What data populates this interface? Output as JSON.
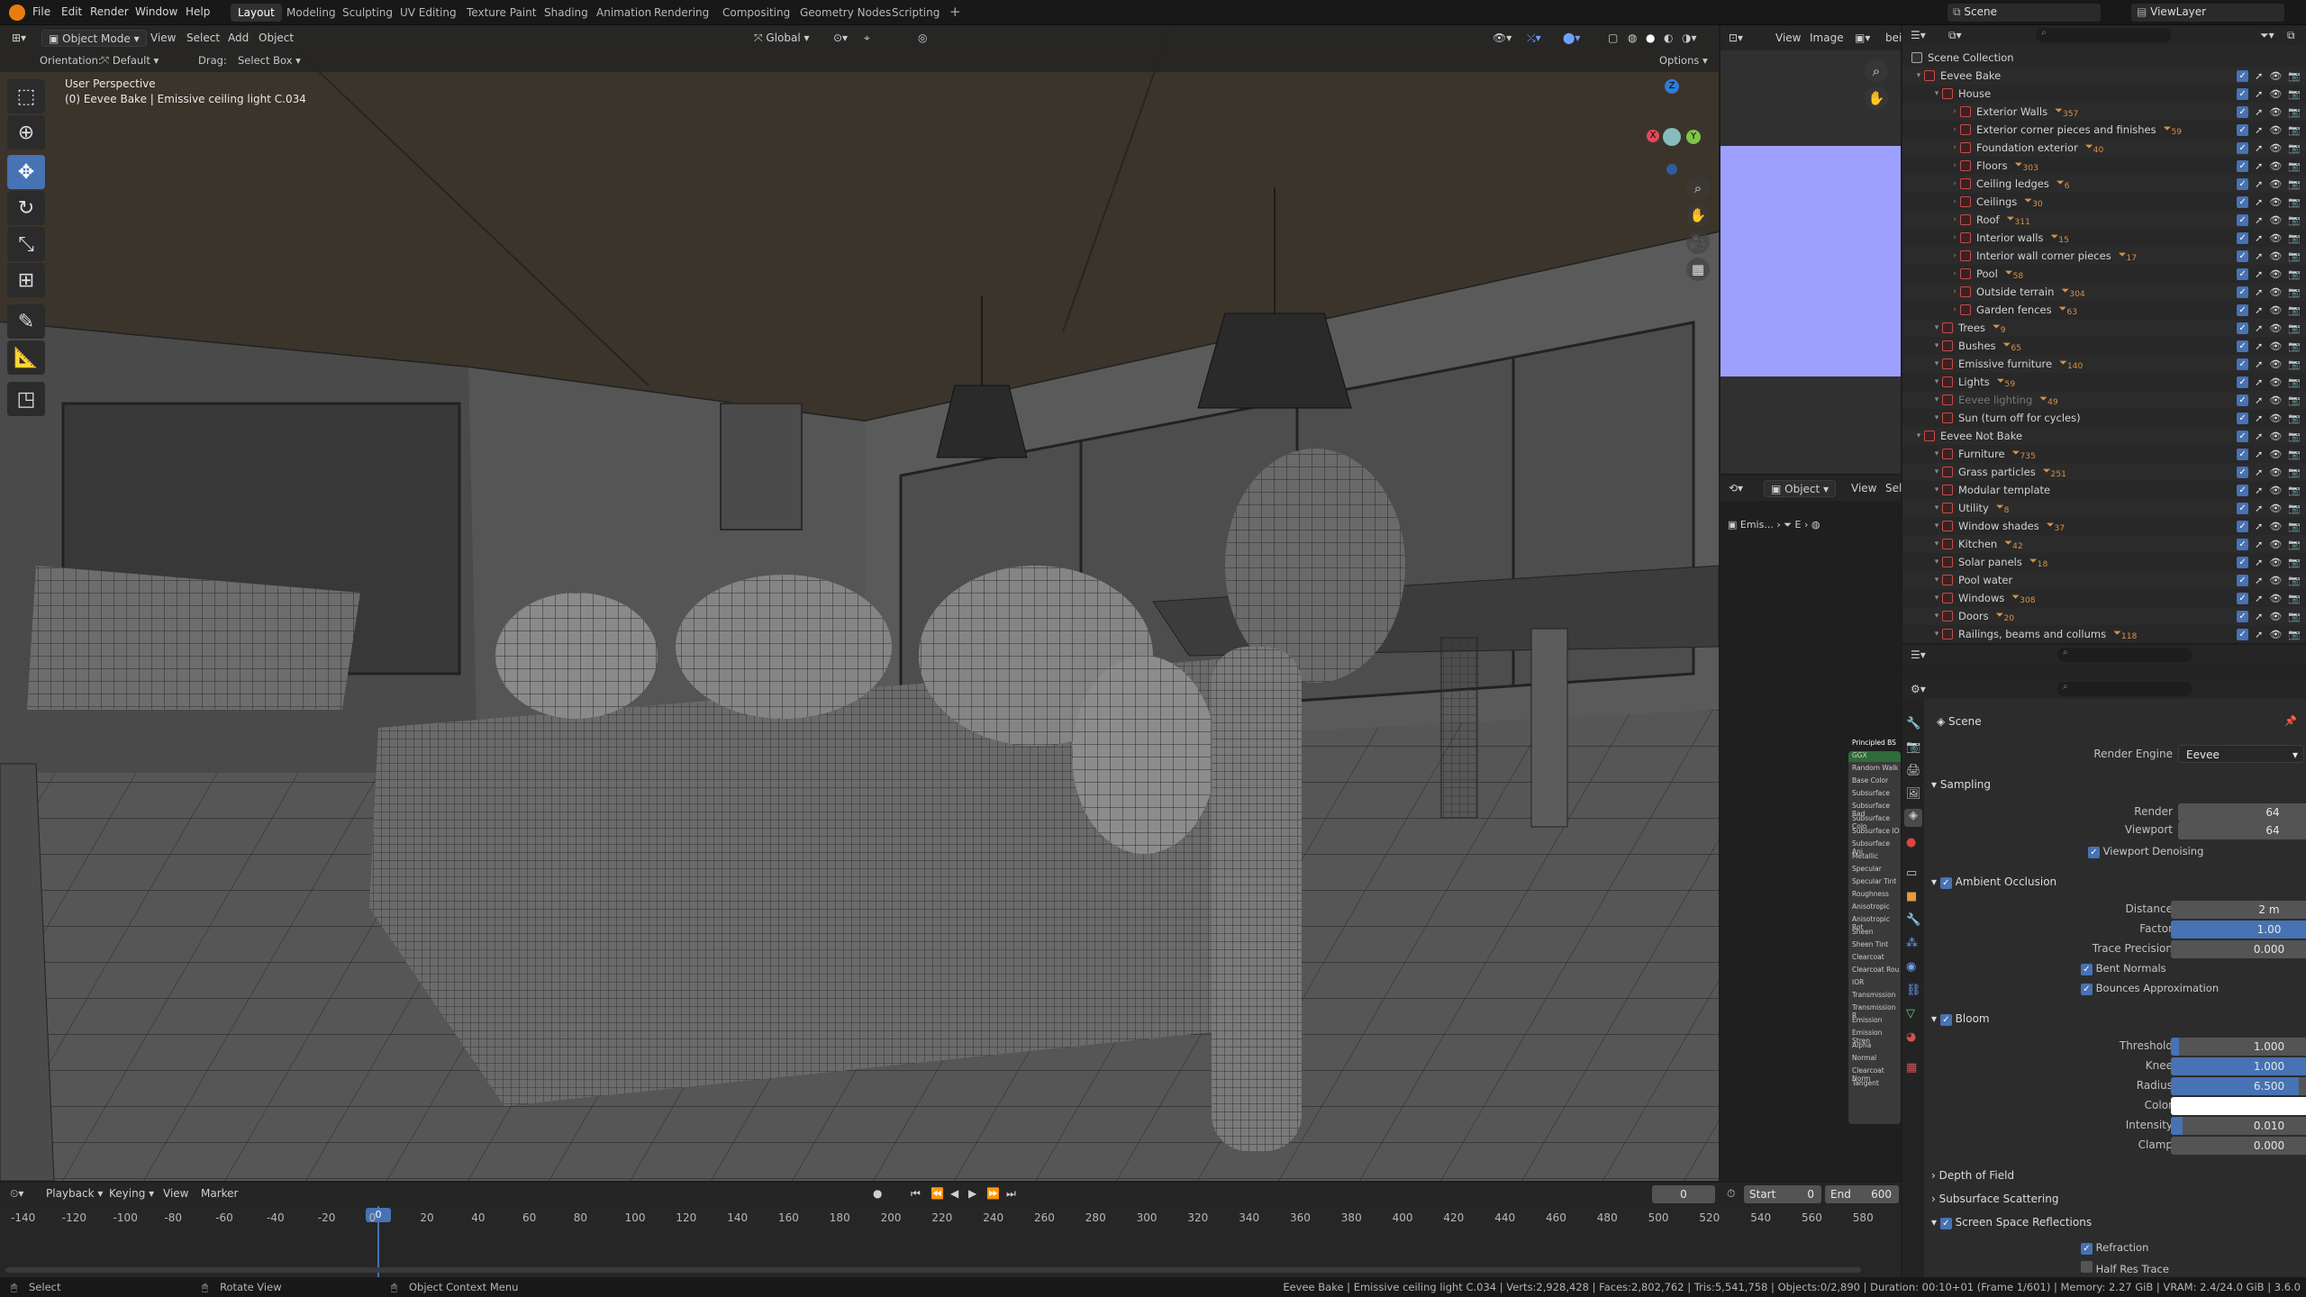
{
  "menus": [
    "File",
    "Edit",
    "Render",
    "Window",
    "Help"
  ],
  "workspaces": [
    "Layout",
    "Modeling",
    "Sculpting",
    "UV Editing",
    "Texture Paint",
    "Shading",
    "Animation",
    "Rendering",
    "Compositing",
    "Geometry Nodes",
    "Scripting"
  ],
  "active_workspace": "Layout",
  "scene": "Scene",
  "view_layer": "ViewLayer",
  "vp_header": {
    "mode": "Object Mode",
    "view": "View",
    "select": "Select",
    "add": "Add",
    "object": "Object",
    "orientation": "Global"
  },
  "vp_sub": {
    "orientation_label": "Orientation:",
    "orientation_value": "Default",
    "drag_label": "Drag:",
    "drag_value": "Select Box",
    "options": "Options"
  },
  "vp_overlay": {
    "perspective": "User Perspective",
    "active": "(0) Eevee Bake | Emissive ceiling light C.034"
  },
  "gizmo": {
    "x": "X",
    "y": "Y",
    "z": "Z"
  },
  "image_editor": {
    "view": "View",
    "image": "Image",
    "tail": "bei"
  },
  "node_editor": {
    "mode": "Object",
    "view": "View",
    "sel": "Sel",
    "path": "Emis...",
    "path2": "E"
  },
  "node_labels": [
    "Principled BS",
    "GGX",
    "Random Walk",
    "Base Color",
    "Subsurface",
    "Subsurface Rad",
    "Subsurface Colo",
    "Subsurface IO",
    "Subsurface Ani",
    "Metallic",
    "Specular",
    "Specular Tint",
    "Roughness",
    "Anisotropic",
    "Anisotropic Rot",
    "Sheen",
    "Sheen Tint",
    "Clearcoat",
    "Clearcoat Rou",
    "IOR",
    "Transmission",
    "Transmission R",
    "Emission",
    "Emission Stren",
    "Alpha",
    "Normal",
    "Clearcoat Norm",
    "Tangent"
  ],
  "outliner": {
    "root": "Scene Collection",
    "rows": [
      {
        "label": "Eevee Bake",
        "lvl": 0,
        "count": ""
      },
      {
        "label": "House",
        "lvl": 1,
        "count": ""
      },
      {
        "label": "Exterior Walls",
        "lvl": 2,
        "count": "357"
      },
      {
        "label": "Exterior corner pieces and finishes",
        "lvl": 2,
        "count": "59"
      },
      {
        "label": "Foundation exterior",
        "lvl": 2,
        "count": "40"
      },
      {
        "label": "Floors",
        "lvl": 2,
        "count": "303"
      },
      {
        "label": "Ceiling ledges",
        "lvl": 2,
        "count": "6"
      },
      {
        "label": "Ceilings",
        "lvl": 2,
        "count": "30"
      },
      {
        "label": "Roof",
        "lvl": 2,
        "count": "311"
      },
      {
        "label": "Interior walls",
        "lvl": 2,
        "count": "15"
      },
      {
        "label": "Interior wall corner pieces",
        "lvl": 2,
        "count": "17"
      },
      {
        "label": "Pool",
        "lvl": 2,
        "count": "58"
      },
      {
        "label": "Outside terrain",
        "lvl": 2,
        "count": "304"
      },
      {
        "label": "Garden fences",
        "lvl": 2,
        "count": "63"
      },
      {
        "label": "Trees",
        "lvl": 1,
        "count": "9"
      },
      {
        "label": "Bushes",
        "lvl": 1,
        "count": "65"
      },
      {
        "label": "Emissive furniture",
        "lvl": 1,
        "count": "140"
      },
      {
        "label": "Lights",
        "lvl": 1,
        "count": "59"
      },
      {
        "label": "Eevee lighting",
        "lvl": 1,
        "count": "49"
      },
      {
        "label": "Sun (turn off for cycles)",
        "lvl": 1,
        "count": ""
      },
      {
        "label": "Eevee Not Bake",
        "lvl": 0,
        "count": ""
      },
      {
        "label": "Furniture",
        "lvl": 1,
        "count": "735"
      },
      {
        "label": "Grass particles",
        "lvl": 1,
        "count": "251"
      },
      {
        "label": "Modular template",
        "lvl": 1,
        "count": ""
      },
      {
        "label": "Utility",
        "lvl": 1,
        "count": "8"
      },
      {
        "label": "Window shades",
        "lvl": 1,
        "count": "37"
      },
      {
        "label": "Kitchen",
        "lvl": 1,
        "count": "42"
      },
      {
        "label": "Solar panels",
        "lvl": 1,
        "count": "18"
      },
      {
        "label": "Pool water",
        "lvl": 1,
        "count": ""
      },
      {
        "label": "Windows",
        "lvl": 1,
        "count": "308"
      },
      {
        "label": "Doors",
        "lvl": 1,
        "count": "20"
      },
      {
        "label": "Railings, beams and collums",
        "lvl": 1,
        "count": "118"
      }
    ]
  },
  "properties": {
    "context": "Scene",
    "render_engine_label": "Render Engine",
    "render_engine": "Eevee",
    "sampling": {
      "title": "Sampling",
      "render_label": "Render",
      "render": "64",
      "viewport_label": "Viewport",
      "viewport": "64",
      "denoise": "Viewport Denoising"
    },
    "ao": {
      "title": "Ambient Occlusion",
      "distance_label": "Distance",
      "distance": "2 m",
      "factor_label": "Factor",
      "factor": "1.00",
      "factor_level": 1.0,
      "trace_label": "Trace Precision",
      "trace": "0.000",
      "bent": "Bent Normals",
      "bounces": "Bounces Approximation"
    },
    "bloom": {
      "title": "Bloom",
      "threshold_label": "Threshold",
      "threshold": "1.000",
      "threshold_level": 0.04,
      "knee_label": "Knee",
      "knee": "1.000",
      "knee_level": 1.0,
      "radius_label": "Radius",
      "radius": "6.500",
      "radius_level": 0.65,
      "color_label": "Color",
      "intensity_label": "Intensity",
      "intensity": "0.010",
      "intensity_level": 0.06,
      "clamp_label": "Clamp",
      "clamp": "0.000"
    },
    "dof": "Depth of Field",
    "sss": "Subsurface Scattering",
    "ssr": {
      "title": "Screen Space Reflections",
      "refraction": "Refraction",
      "half": "Half Res Trace"
    }
  },
  "timeline": {
    "playback": "Playback",
    "keying": "Keying",
    "view": "View",
    "marker": "Marker",
    "current": "0",
    "start_label": "Start",
    "start": "0",
    "end_label": "End",
    "end": "600",
    "frame_marker": "0",
    "ticks": [
      "-140",
      "-120",
      "-100",
      "-80",
      "-60",
      "-40",
      "-20",
      "0",
      "20",
      "40",
      "60",
      "80",
      "100",
      "120",
      "140",
      "160",
      "180",
      "200",
      "220",
      "240",
      "260",
      "280",
      "300",
      "320",
      "340",
      "360",
      "380",
      "400",
      "420",
      "440",
      "460",
      "480",
      "500",
      "520",
      "540",
      "560",
      "580"
    ]
  },
  "statusbar": {
    "select": "Select",
    "rotate": "Rotate View",
    "context": "Object Context Menu",
    "stats": "Eevee Bake | Emissive ceiling light C.034 | Verts:2,928,428 | Faces:2,802,762 | Tris:5,541,758 | Objects:0/2,890 | Duration: 00:10+01 (Frame 1/601) | Memory: 2.27 GiB | VRAM: 2.4/24.0 GiB | 3.6.0"
  },
  "colors": {
    "accent": "#4772b3",
    "collection": "#c84a4a",
    "preview": "#9ea0ff"
  }
}
